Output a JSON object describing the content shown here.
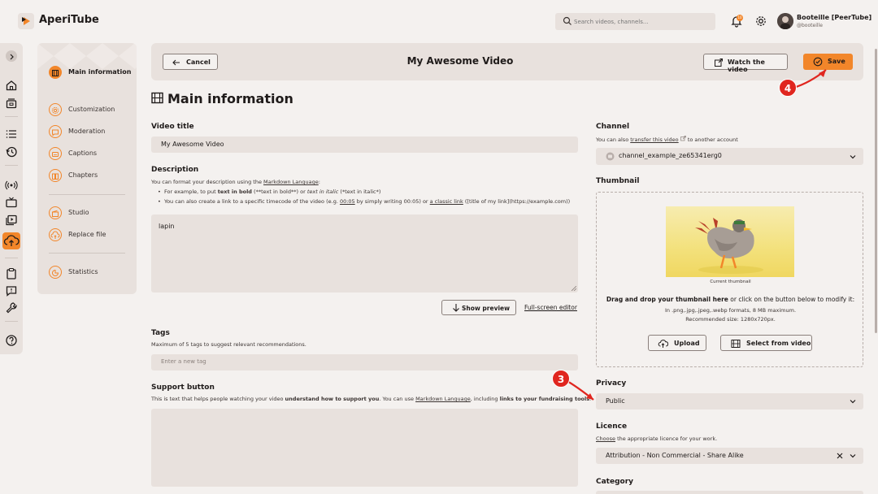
{
  "app": {
    "name": "AperiTube"
  },
  "header": {
    "search_placeholder": "Search videos, channels...",
    "notification_count": "10",
    "user": {
      "name": "Booteille [PeerTube]",
      "handle": "@booteille"
    }
  },
  "menu": {
    "items": [
      {
        "label": "Main information",
        "icon": "film-icon",
        "active": true
      },
      {
        "label": "Customization",
        "icon": "settings-icon"
      },
      {
        "label": "Moderation",
        "icon": "message-icon"
      },
      {
        "label": "Captions",
        "icon": "captions-icon"
      },
      {
        "label": "Chapters",
        "icon": "book-icon"
      },
      {
        "label": "Studio",
        "icon": "studio-icon"
      },
      {
        "label": "Replace file",
        "icon": "replace-file-icon"
      },
      {
        "label": "Statistics",
        "icon": "stats-icon"
      }
    ]
  },
  "actionbar": {
    "cancel_label": "Cancel",
    "video_title": "My Awesome Video",
    "watch_label": "Watch the video",
    "save_label": "Save"
  },
  "main": {
    "heading": "Main information",
    "video_title": {
      "label": "Video title",
      "value": "My Awesome Video"
    },
    "description": {
      "label": "Description",
      "help_prefix": "You can format your description using the ",
      "help_link": "Markdown Language",
      "help_suffix": ":",
      "bullet1_prefix": "For example, to put ",
      "bullet1_bold": "text in bold",
      "bullet1_mid": " (**text in bold**) or ",
      "bullet1_italic": "text in italic",
      "bullet1_suffix": " (*text in italic*)",
      "bullet2_prefix": "You can also create a link to a specific timecode of the video (e.g. ",
      "bullet2_link1": "00:05",
      "bullet2_mid": " by simply writing 00:05) or ",
      "bullet2_link2": "a classic link",
      "bullet2_suffix": " ([title of my link](https://example.com))",
      "value": "lapin",
      "show_preview": "Show preview",
      "fullscreen": "Full-screen editor"
    },
    "tags": {
      "label": "Tags",
      "help": "Maximum of 5 tags to suggest relevant recommendations.",
      "placeholder": "Enter a new tag"
    },
    "support": {
      "label": "Support button",
      "help_prefix": "This is text that helps people watching your video ",
      "help_bold1": "understand how to support you",
      "help_mid": ". You can use ",
      "help_link": "Markdown Language",
      "help_mid2": ", including ",
      "help_bold2": "links to your fundraising tools",
      "help_suffix": "."
    }
  },
  "side": {
    "channel": {
      "label": "Channel",
      "help_prefix": "You can also ",
      "help_link": "transfer this video",
      "help_suffix": " to another account",
      "value": "channel_example_ze65341erg0"
    },
    "thumbnail": {
      "label": "Thumbnail",
      "caption": "Current thumbnail",
      "drag_bold": "Drag and drop your thumbnail here",
      "drag_rest": " or click on the button below to modify it:",
      "formats": "In .png,.jpg,.jpeg,.webp formats, 8 MB maximum.",
      "size": "Recommended size: 1280x720px.",
      "upload": "Upload",
      "select_from_video": "Select from video"
    },
    "privacy": {
      "label": "Privacy",
      "value": "Public"
    },
    "licence": {
      "label": "Licence",
      "help_link": "Choose",
      "help_suffix": " the appropriate licence for your work.",
      "value": "Attribution - Non Commercial - Share Alike"
    },
    "category": {
      "label": "Category"
    }
  },
  "annotations": {
    "step3": "3",
    "step4": "4"
  },
  "colors": {
    "accent": "#f2862a",
    "surface": "#e8e1dd",
    "background": "#f4f1ef",
    "annotation": "#e0261f"
  }
}
